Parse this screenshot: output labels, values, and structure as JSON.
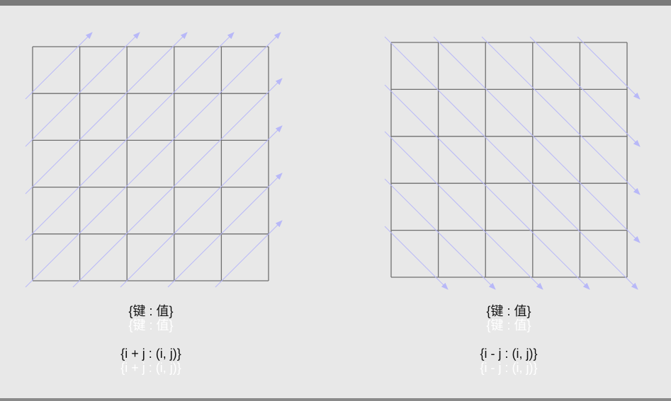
{
  "colors": {
    "grid": "#6f6f6f",
    "arrows": "#b8b8f8",
    "text": "#111111",
    "ghost_text": "#ffffff"
  },
  "left_panel": {
    "grid_size": 5,
    "arrow_direction": "up-right (anti-diagonals)",
    "caption_line1": "{键 : 值}",
    "caption_line1_ghost": "{键 : 值}",
    "caption_line2": "{i + j : (i, j)}",
    "caption_line2_ghost": "{i + j : (i, j)}"
  },
  "right_panel": {
    "grid_size": 5,
    "arrow_direction": "down-right (diagonals)",
    "caption_line1": "{键 : 值}",
    "caption_line1_ghost": "{键 : 值}",
    "caption_line2": "{i - j : (i, j)}",
    "caption_line2_ghost": "{i - j : (i, j)}"
  }
}
